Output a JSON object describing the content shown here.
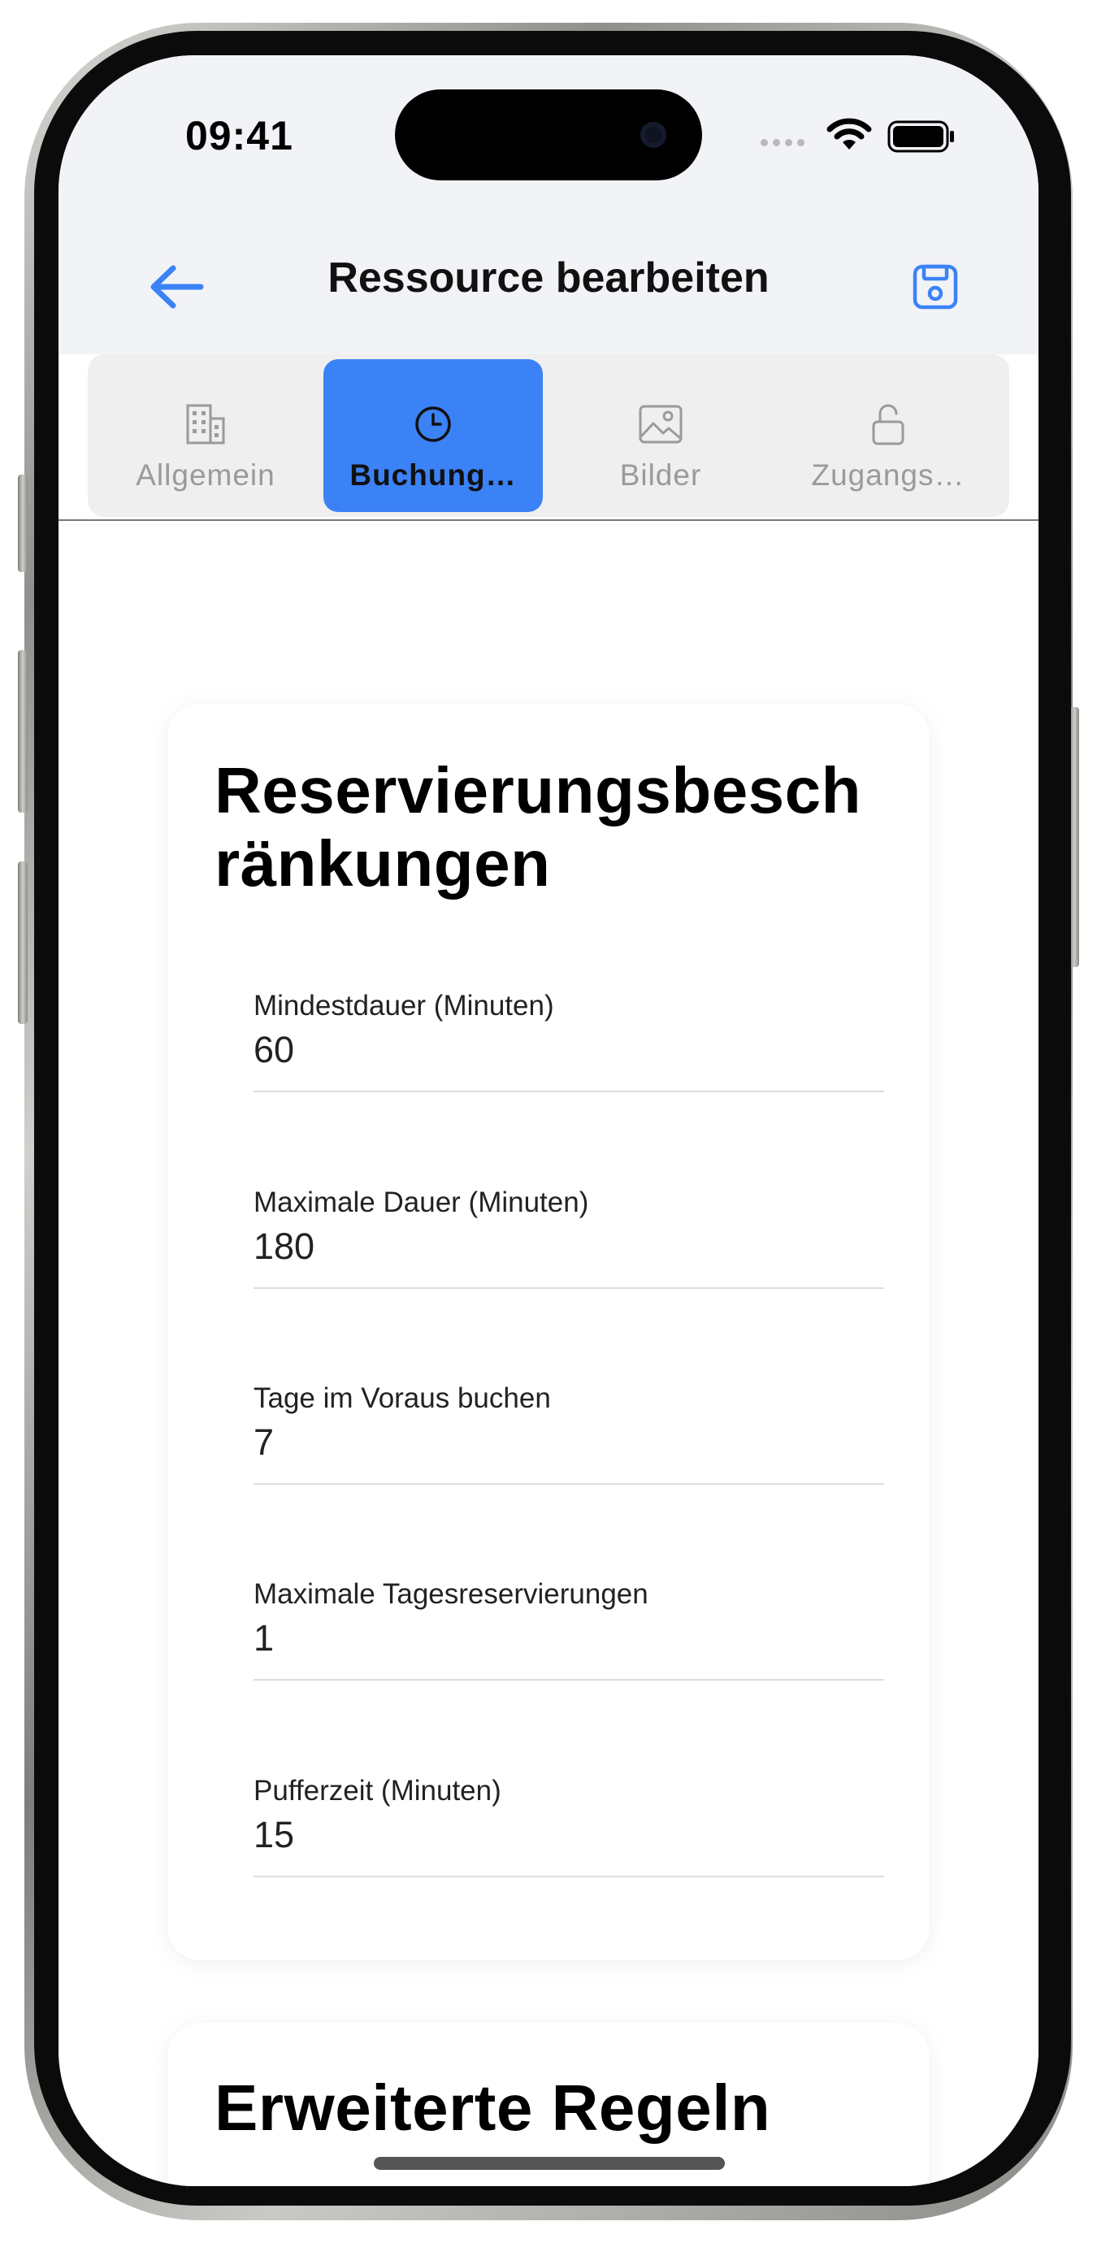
{
  "status_bar": {
    "time": "09:41"
  },
  "nav": {
    "title": "Ressource bearbeiten",
    "back_icon": "arrow-left-icon",
    "save_icon": "save-icon"
  },
  "tabs": [
    {
      "label": "Allgemein",
      "icon": "building-icon",
      "active": false
    },
    {
      "label": "Buchung…",
      "icon": "clock-icon",
      "active": true
    },
    {
      "label": "Bilder",
      "icon": "image-icon",
      "active": false
    },
    {
      "label": "Zugangs…",
      "icon": "unlock-icon",
      "active": false
    }
  ],
  "restrictions_card": {
    "title": "Reservierungsbesch ränkungen",
    "fields": [
      {
        "label": "Mindestdauer (Minuten)",
        "value": "60"
      },
      {
        "label": "Maximale Dauer (Minuten)",
        "value": "180"
      },
      {
        "label": "Tage im Voraus buchen",
        "value": "7"
      },
      {
        "label": "Maximale Tagesreservierungen",
        "value": "1"
      },
      {
        "label": "Pufferzeit (Minuten)",
        "value": "15"
      }
    ]
  },
  "advanced_card": {
    "title": "Erweiterte Regeln",
    "toggle_on": true
  },
  "colors": {
    "accent": "#3b82f6",
    "background": "#f2f3f7"
  }
}
